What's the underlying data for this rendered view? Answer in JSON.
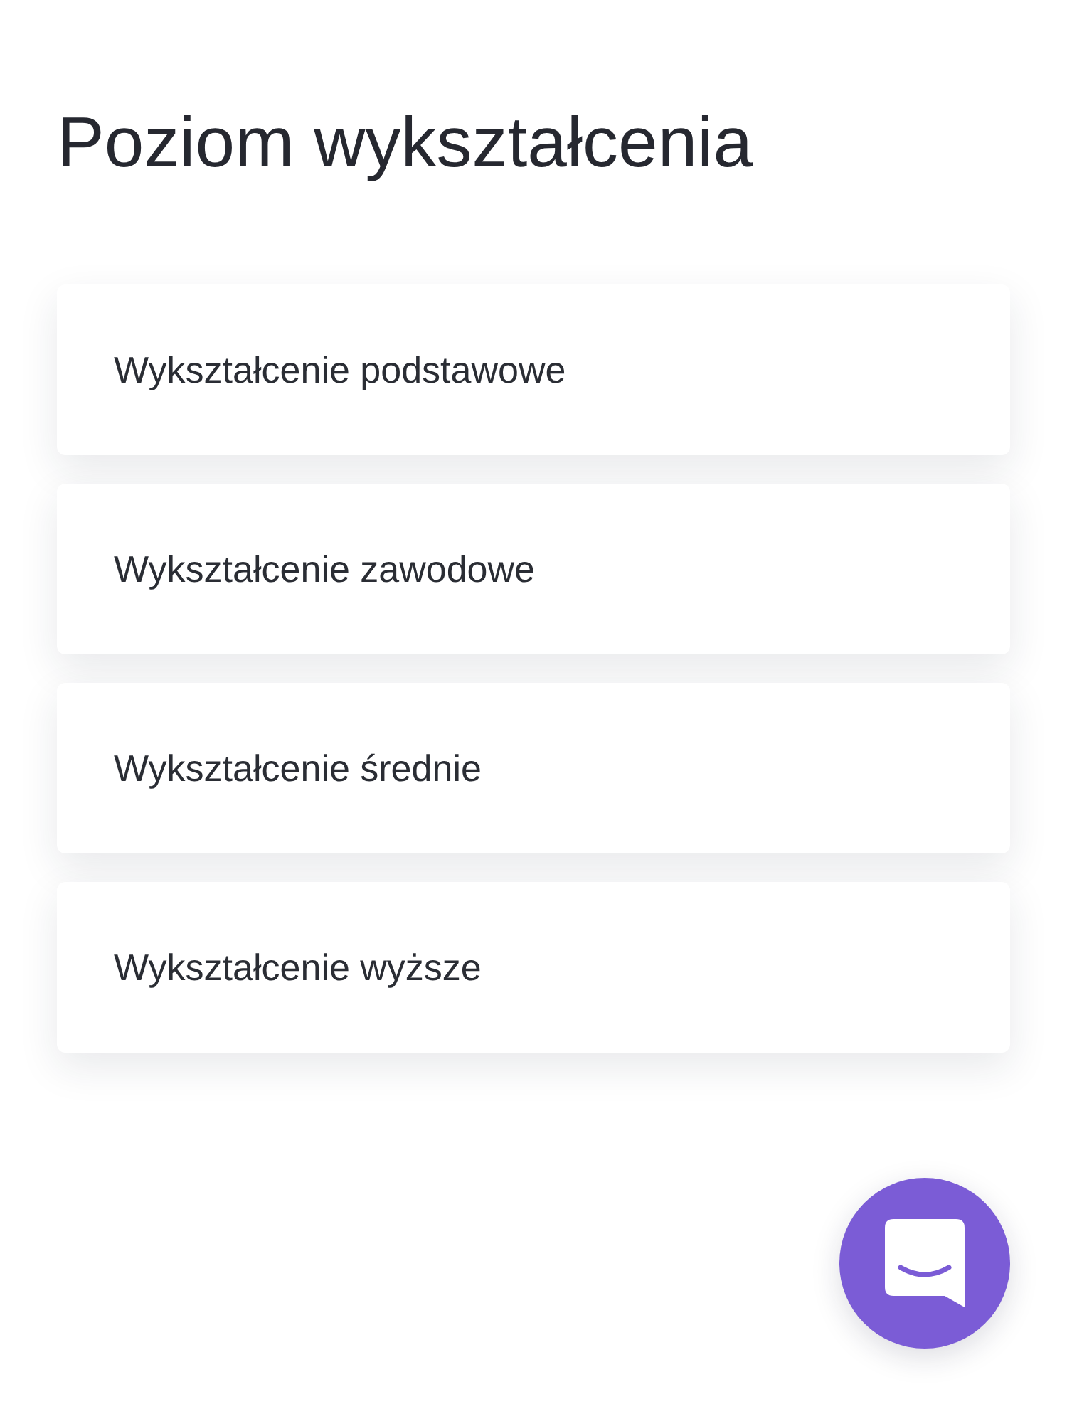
{
  "page": {
    "title": "Poziom wykształcenia"
  },
  "options": [
    {
      "label": "Wykształcenie podstawowe"
    },
    {
      "label": "Wykształcenie zawodowe"
    },
    {
      "label": "Wykształcenie średnie"
    },
    {
      "label": "Wykształcenie wyższe"
    }
  ]
}
